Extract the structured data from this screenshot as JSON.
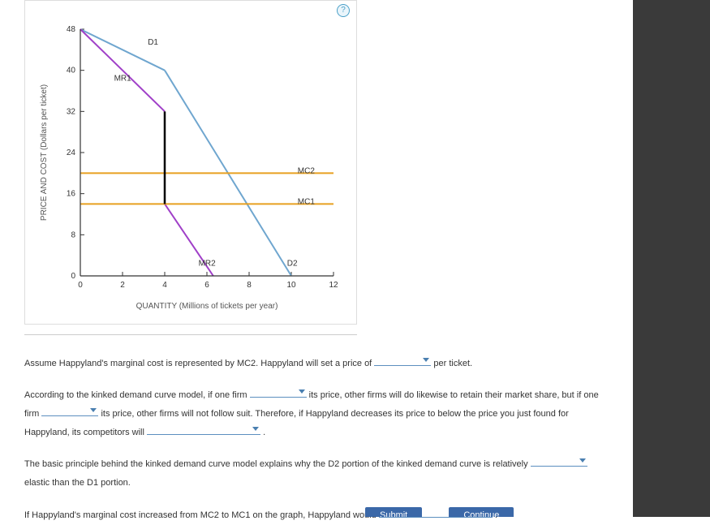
{
  "help_label": "?",
  "chart_data": {
    "type": "line",
    "xlabel": "QUANTITY (Millions of tickets per year)",
    "ylabel": "PRICE AND COST (Dollars per ticket)",
    "xlim": [
      0,
      12
    ],
    "ylim": [
      0,
      48
    ],
    "xticks": [
      0,
      2,
      4,
      6,
      8,
      10,
      12
    ],
    "yticks": [
      0,
      8,
      16,
      24,
      32,
      40,
      48
    ],
    "series": [
      {
        "name": "D1",
        "color": "#6fa6cf",
        "points": [
          [
            0,
            48
          ],
          [
            4,
            40
          ]
        ]
      },
      {
        "name": "D2",
        "color": "#6fa6cf",
        "points": [
          [
            4,
            40
          ],
          [
            10,
            0
          ]
        ]
      },
      {
        "name": "MR1",
        "color": "#a040c8",
        "points": [
          [
            0,
            48
          ],
          [
            4,
            32
          ]
        ]
      },
      {
        "name": "MR2",
        "color": "#a040c8",
        "points": [
          [
            4,
            32
          ],
          [
            4,
            14
          ],
          [
            6.3,
            0
          ]
        ]
      },
      {
        "name": "MC1",
        "color": "#e8a020",
        "points": [
          [
            0,
            14
          ],
          [
            12,
            14
          ]
        ]
      },
      {
        "name": "MC2",
        "color": "#e8a020",
        "points": [
          [
            0,
            20
          ],
          [
            12,
            20
          ]
        ]
      }
    ],
    "vertical_gap": {
      "x": 4,
      "y1": 32,
      "y2": 14,
      "color": "#000"
    },
    "labels": [
      {
        "text": "D1",
        "x": 3.2,
        "y": 45
      },
      {
        "text": "MR1",
        "x": 1.6,
        "y": 38
      },
      {
        "text": "MR2",
        "x": 5.6,
        "y": 2
      },
      {
        "text": "D2",
        "x": 9.8,
        "y": 2
      },
      {
        "text": "MC2",
        "x": 10.3,
        "y": 20
      },
      {
        "text": "MC1",
        "x": 10.3,
        "y": 14
      }
    ]
  },
  "paragraphs": {
    "p1_a": "Assume Happyland's marginal cost is represented by MC2. Happyland will set a price of ",
    "p1_b": " per ticket.",
    "p2_a": "According to the kinked demand curve model, if one firm ",
    "p2_b": " its price, other firms will do likewise to retain their market share, but if one firm ",
    "p2_c": " its price, other firms will not follow suit. Therefore, if Happyland decreases its price to below the price you just found for Happyland, its competitors will ",
    "p2_d": " .",
    "p3_a": "The basic principle behind the kinked demand curve model explains why the D2 portion of the kinked demand curve is relatively ",
    "p3_b": " elastic than the D1 portion.",
    "p4_a": "If Happyland's marginal cost increased from MC2 to MC1 on the graph, Happyland would ",
    "p4_b": " ."
  },
  "buttons": {
    "b1": "Submit",
    "b2": "Continue"
  }
}
